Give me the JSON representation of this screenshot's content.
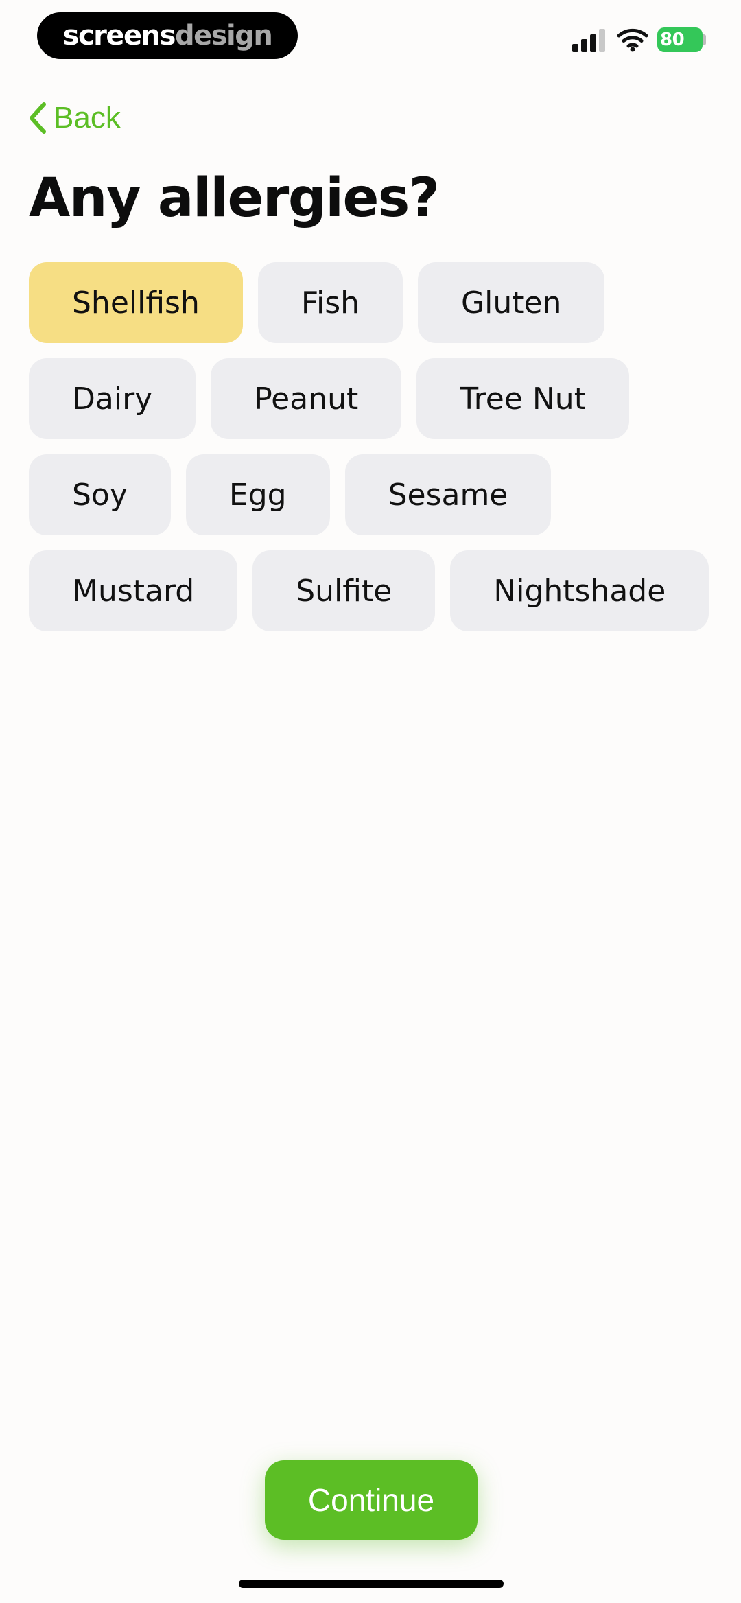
{
  "status_bar": {
    "watermark_part1": "screens",
    "watermark_part2": "design",
    "battery_level": "80",
    "icons": [
      "cellular-signal-icon",
      "wifi-icon",
      "battery-charging-icon"
    ]
  },
  "nav": {
    "back_label": "Back",
    "back_icon": "chevron-left-icon"
  },
  "title": "Any allergies?",
  "allergies": [
    {
      "label": "Shellfish",
      "selected": true
    },
    {
      "label": "Fish",
      "selected": false
    },
    {
      "label": "Gluten",
      "selected": false
    },
    {
      "label": "Dairy",
      "selected": false
    },
    {
      "label": "Peanut",
      "selected": false
    },
    {
      "label": "Tree Nut",
      "selected": false
    },
    {
      "label": "Soy",
      "selected": false
    },
    {
      "label": "Egg",
      "selected": false
    },
    {
      "label": "Sesame",
      "selected": false
    },
    {
      "label": "Mustard",
      "selected": false
    },
    {
      "label": "Sulfite",
      "selected": false
    },
    {
      "label": "Nightshade",
      "selected": false
    }
  ],
  "continue_label": "Continue",
  "colors": {
    "accent_green": "#5cbe25",
    "selected_chip": "#f6de84",
    "chip_background": "#ededf0",
    "battery_green": "#34c759",
    "page_background": "#fdfcfb"
  }
}
